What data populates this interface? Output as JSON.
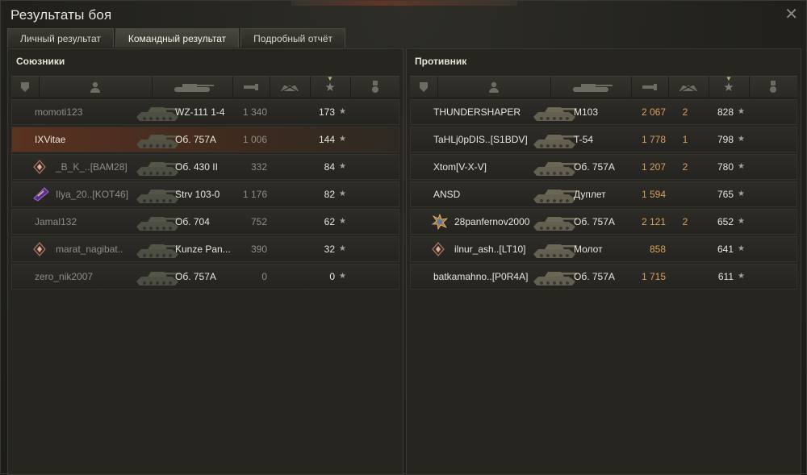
{
  "window": {
    "title": "Результаты боя"
  },
  "tabs": [
    {
      "label": "Личный результат",
      "active": false
    },
    {
      "label": "Командный результат",
      "active": true
    },
    {
      "label": "Подробный отчёт",
      "active": false
    }
  ],
  "allies": {
    "title": "Союзники",
    "rows": [
      {
        "player": "momoti123",
        "tank": "WZ-111 1-4",
        "damage": "1 340",
        "frags": "",
        "xp": "173",
        "emblem": "",
        "highlight": false
      },
      {
        "player": "IXVitae",
        "tank": "Об. 757А",
        "damage": "1 006",
        "frags": "",
        "xp": "144",
        "emblem": "",
        "highlight": true
      },
      {
        "player": "_B_K_..[BAM28]",
        "tank": "Об. 430 II",
        "damage": "332",
        "frags": "",
        "xp": "84",
        "emblem": "diamond",
        "highlight": false
      },
      {
        "player": "Ilya_20..[KOT46]",
        "tank": "Strv 103-0",
        "damage": "1 176",
        "frags": "",
        "xp": "82",
        "emblem": "purple",
        "highlight": false
      },
      {
        "player": "Jamal132",
        "tank": "Об. 704",
        "damage": "752",
        "frags": "",
        "xp": "62",
        "emblem": "",
        "highlight": false
      },
      {
        "player": "marat_nagibat..",
        "tank": "Kunze Pan...",
        "damage": "390",
        "frags": "",
        "xp": "32",
        "emblem": "diamond",
        "highlight": false
      },
      {
        "player": "zero_nik2007",
        "tank": "Об. 757А",
        "damage": "0",
        "frags": "",
        "xp": "0",
        "emblem": "",
        "highlight": false
      }
    ]
  },
  "enemies": {
    "title": "Противник",
    "rows": [
      {
        "player": "THUNDERSHAPER",
        "tank": "M103",
        "damage": "2 067",
        "frags": "2",
        "xp": "828",
        "emblem": ""
      },
      {
        "player": "TaHLj0pDIS..[S1BDV]",
        "tank": "T-54",
        "damage": "1 778",
        "frags": "1",
        "xp": "798",
        "emblem": ""
      },
      {
        "player": "Xtom[V-X-V]",
        "tank": "Об. 757А",
        "damage": "1 207",
        "frags": "2",
        "xp": "780",
        "emblem": ""
      },
      {
        "player": "ANSD",
        "tank": "Дуплет",
        "damage": "1 594",
        "frags": "",
        "xp": "765",
        "emblem": ""
      },
      {
        "player": "28panfernov2000",
        "tank": "Об. 757А",
        "damage": "2 121",
        "frags": "2",
        "xp": "652",
        "emblem": "burst"
      },
      {
        "player": "ilnur_ash..[LT10]",
        "tank": "Молот",
        "damage": "858",
        "frags": "",
        "xp": "641",
        "emblem": "diamond"
      },
      {
        "player": "batkamahno..[P0R4A]",
        "tank": "Об. 757А",
        "damage": "1 715",
        "frags": "",
        "xp": "611",
        "emblem": ""
      }
    ]
  },
  "colors": {
    "highlight_row": "#5a3220",
    "damage_enemy": "#d9a05a"
  }
}
